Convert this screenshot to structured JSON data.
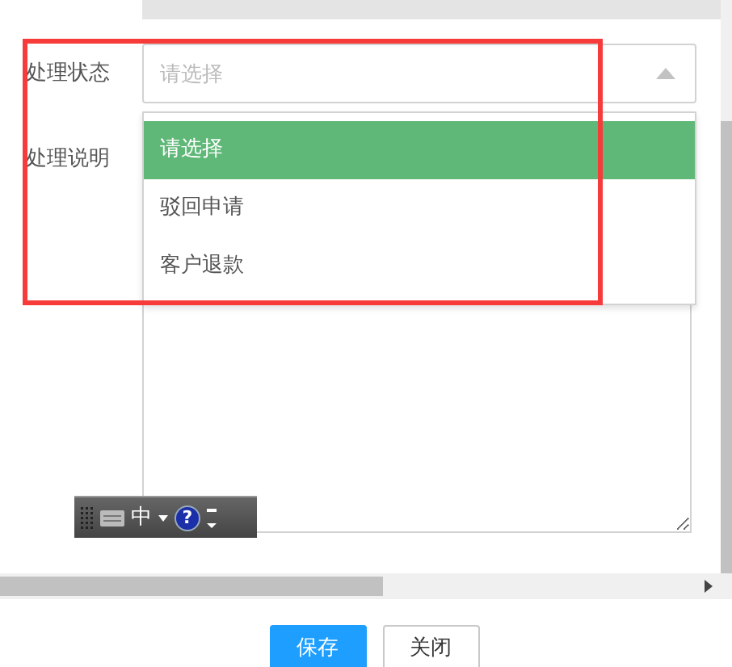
{
  "form": {
    "status": {
      "label": "处理状态",
      "placeholder": "请选择",
      "expanded": true,
      "options": [
        {
          "label": "请选择",
          "selected": true
        },
        {
          "label": "驳回申请",
          "selected": false
        },
        {
          "label": "客户退款",
          "selected": false
        }
      ]
    },
    "note": {
      "label": "处理说明"
    }
  },
  "ime_bar": {
    "mode": "中",
    "help": "?"
  },
  "buttons": [
    {
      "label": "保存",
      "kind": "primary"
    },
    {
      "label": "关闭",
      "kind": "default"
    }
  ]
}
